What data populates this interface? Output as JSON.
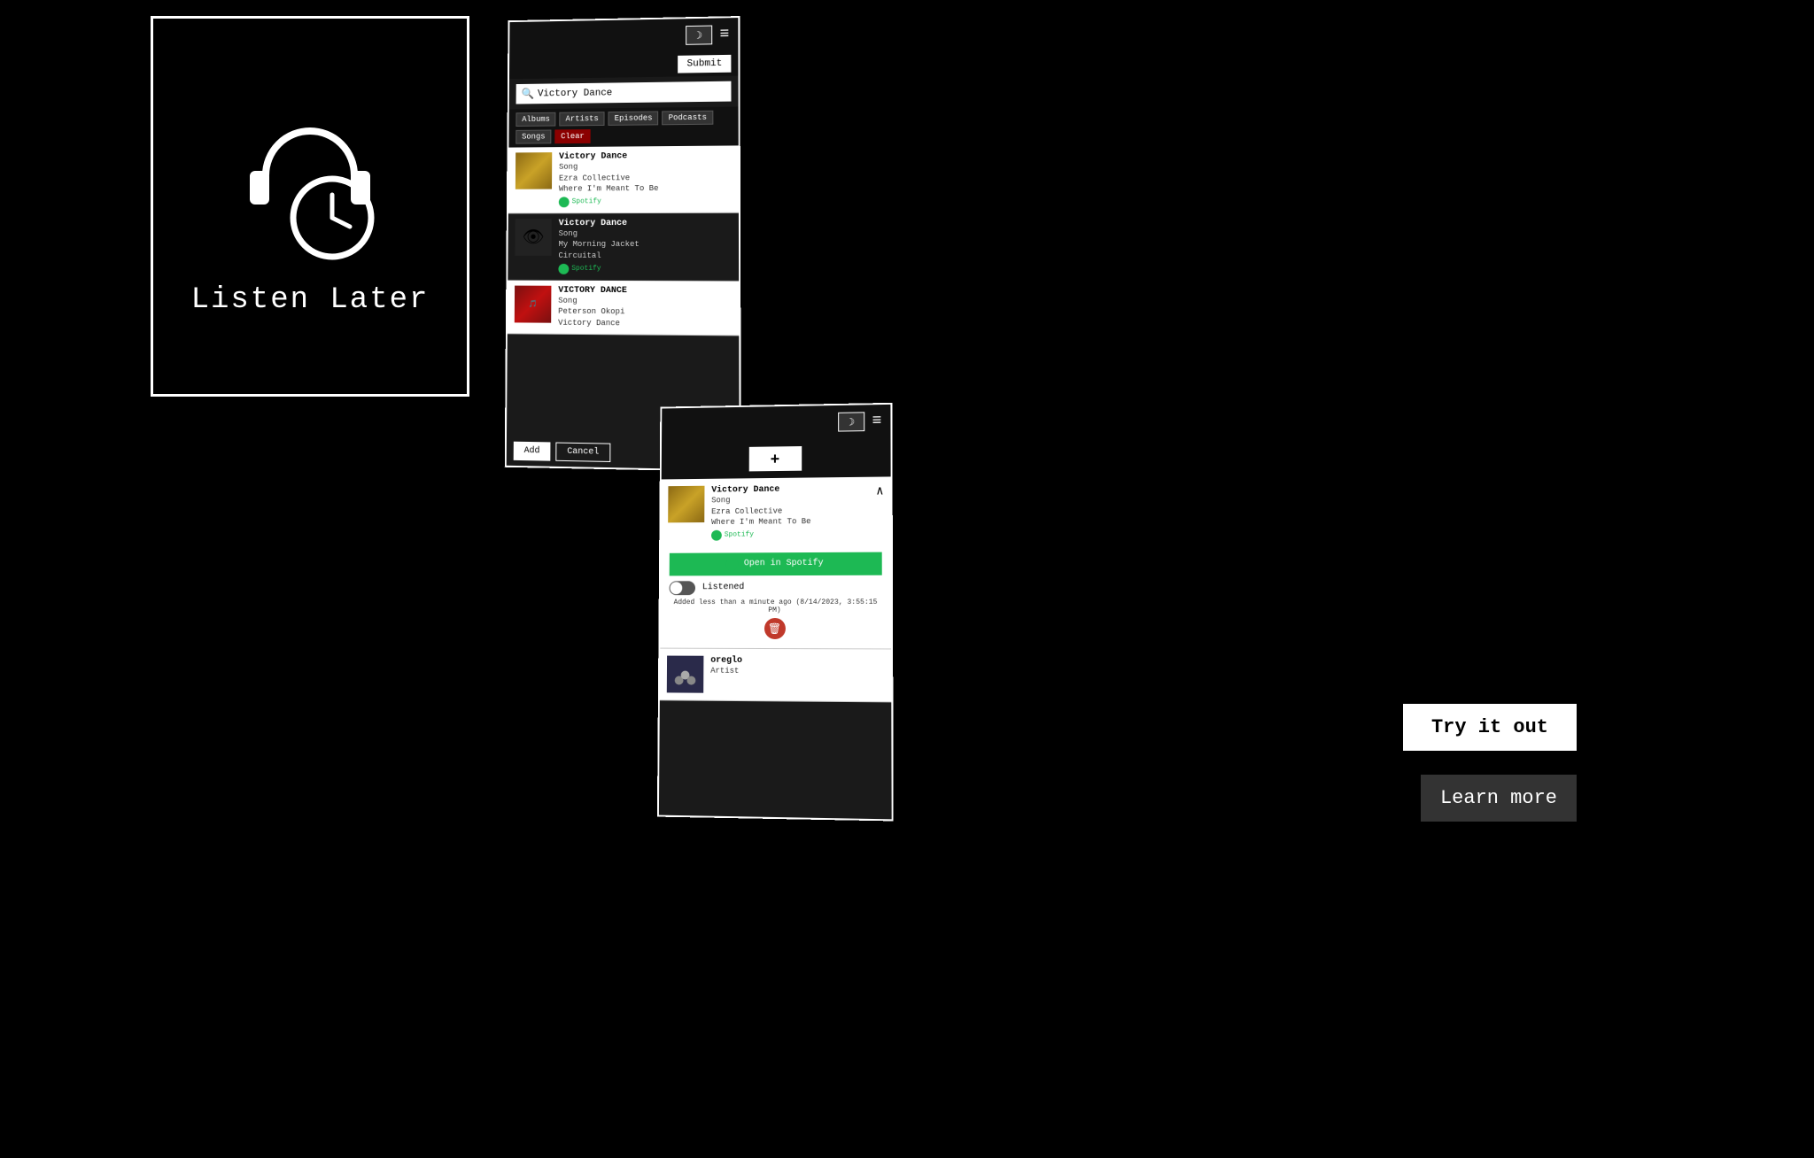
{
  "app": {
    "name": "Listen Later",
    "background": "#000000"
  },
  "logo": {
    "title": "Listen Later"
  },
  "phone1": {
    "topbar": {
      "moon_icon": "☽",
      "menu_icon": "≡"
    },
    "submit_button": "Submit",
    "search": {
      "placeholder": "Victory Dance",
      "value": "Victory Dance"
    },
    "filters": [
      {
        "label": "Albums",
        "active": false
      },
      {
        "label": "Artists",
        "active": false
      },
      {
        "label": "Episodes",
        "active": false
      },
      {
        "label": "Podcasts",
        "active": false
      },
      {
        "label": "Songs",
        "active": false
      },
      {
        "label": "Clear",
        "active": true
      }
    ],
    "results": [
      {
        "title": "Victory Dance",
        "type": "Song",
        "artist": "Ezra Collective",
        "album": "Where I'm Meant To Be",
        "thumb_type": "gold",
        "dark": false
      },
      {
        "title": "Victory Dance",
        "type": "Song",
        "artist": "My Morning Jacket",
        "album": "Circuital",
        "thumb_type": "green-eye",
        "dark": true
      },
      {
        "title": "VICTORY DANCE",
        "type": "Song",
        "artist": "Peterson Okopi",
        "album": "Victory Dance",
        "thumb_type": "red-album",
        "dark": false
      }
    ],
    "actions": {
      "add": "Add",
      "cancel": "Cancel"
    }
  },
  "phone2": {
    "topbar": {
      "moon_icon": "☽",
      "menu_icon": "≡"
    },
    "fab_label": "+",
    "list_items": [
      {
        "title": "Victory Dance",
        "type": "Song",
        "artist": "Ezra Collective",
        "album": "Where I'm Meant To Be",
        "thumb_type": "gold2",
        "expanded": true,
        "open_spotify_label": "Open in Spotify",
        "listened_label": "Listened",
        "added_info": "Added less than a minute ago (8/14/2023, 3:55:15 PM)"
      },
      {
        "title": "oreglo",
        "type": "Artist",
        "thumb_type": "dark-group",
        "expanded": false
      }
    ]
  },
  "cta": {
    "try_label": "Try it out",
    "learn_label": "Learn more"
  }
}
